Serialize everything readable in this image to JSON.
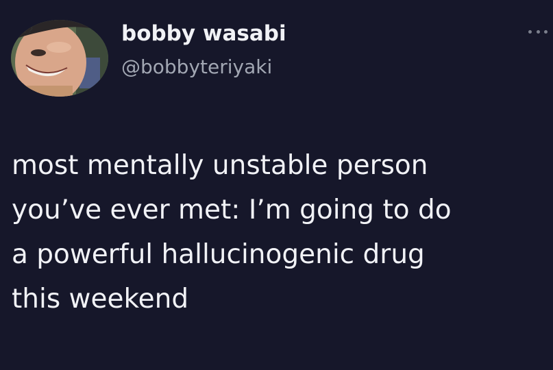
{
  "author": {
    "display_name": "bobby wasabi",
    "handle": "@bobbyteriyaki",
    "avatar_caption": "???"
  },
  "tweet": {
    "lines": [
      "most mentally unstable person",
      "you’ve ever met: I’m going to do",
      "a powerful hallucinogenic drug",
      "this weekend"
    ]
  },
  "icons": {
    "more": "more-horizontal-icon"
  },
  "colors": {
    "background": "#16172a",
    "primary_text": "#f1f2f6",
    "secondary_text": "#a2a7b3",
    "icon_gray": "#7b7f8c"
  }
}
